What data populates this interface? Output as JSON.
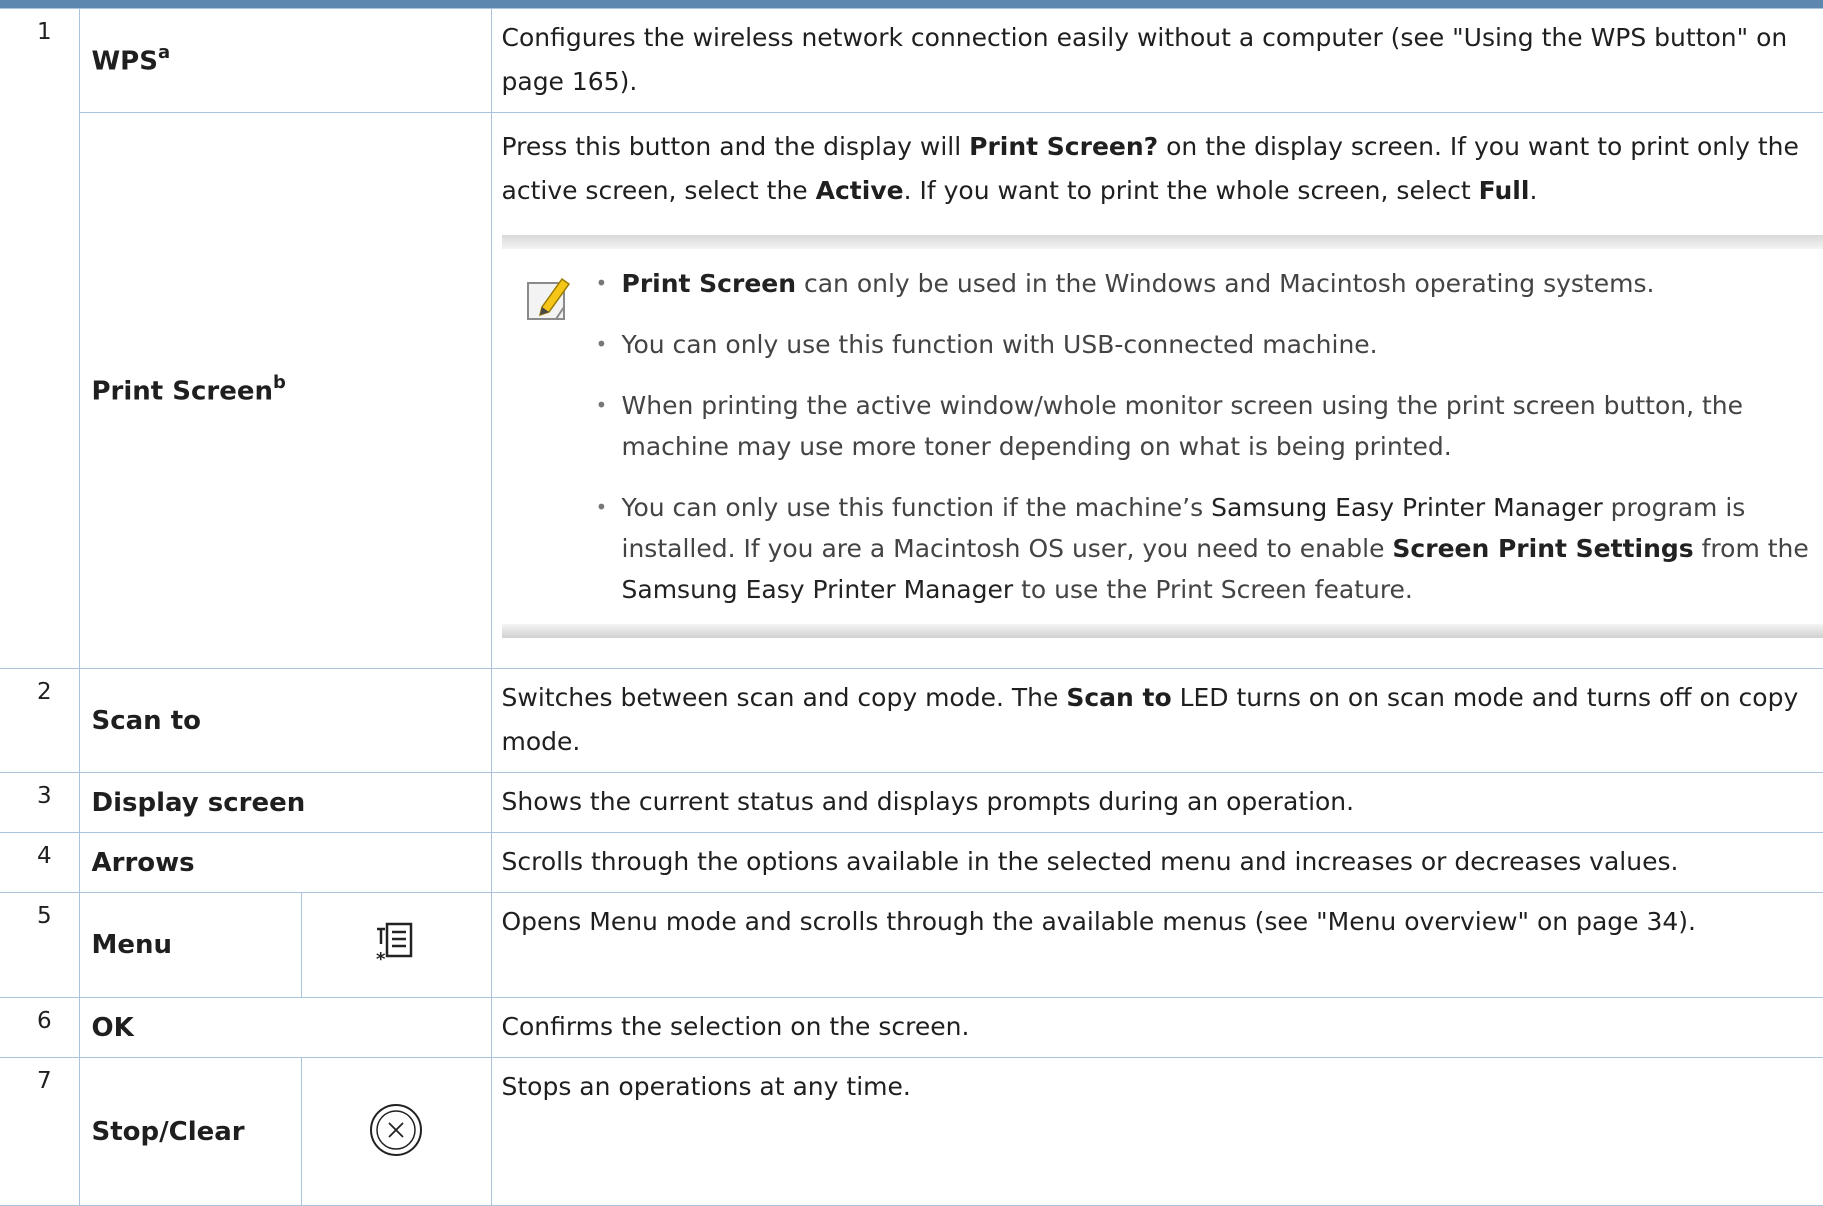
{
  "rows": [
    {
      "num": "1",
      "name": "WPS",
      "sup": "a",
      "desc": "Configures the wireless network connection easily without a computer (see \"Using the WPS button\" on page 165)."
    },
    {
      "num": "",
      "name": "Print Screen",
      "sup": "b",
      "desc_parts": {
        "p1": "Press this button and the display will ",
        "b1": "Print Screen?",
        "p2": " on the display screen. If you want to print only the active screen, select the ",
        "b2": "Active",
        "p3": ". If you want to print the whole screen, select ",
        "b3": "Full",
        "p4": "."
      },
      "note": {
        "icon": "note-pencil-icon",
        "item1_b": "Print Screen",
        "item1_rest": " can only be used in the Windows and Macintosh operating systems.",
        "item2": "You can only use this function with USB-connected machine.",
        "item3": "When printing the active window/whole monitor screen using the print screen button, the machine may use more toner depending on what is being printed.",
        "item4_a": "You can only use this function if the machine’s ",
        "item4_b": "Samsung Easy Printer Manager",
        "item4_c": " program is installed. If you are a Macintosh OS user, you need to enable ",
        "item4_d": "Screen Print Settings",
        "item4_e": " from the ",
        "item4_f": "Samsung Easy Printer Manager",
        "item4_g": " to use the Print Screen feature."
      }
    },
    {
      "num": "2",
      "name": "Scan to",
      "desc_parts": {
        "p1": "Switches between scan and copy mode. The ",
        "b1": "Scan to",
        "p2": " LED turns on on scan mode and turns off on copy mode."
      }
    },
    {
      "num": "3",
      "name": "Display screen",
      "desc": "Shows the current status and displays prompts during an operation."
    },
    {
      "num": "4",
      "name": "Arrows",
      "desc": "Scrolls through the options available in the selected menu and increases or decreases values."
    },
    {
      "num": "5",
      "name": "Menu",
      "icon": "menu-icon",
      "desc": "Opens Menu mode and scrolls through the available menus (see \"Menu overview\" on page 34)."
    },
    {
      "num": "6",
      "name": "OK",
      "desc": "Confirms the selection on the screen."
    },
    {
      "num": "7",
      "name": "Stop/Clear",
      "icon": "stop-clear-icon",
      "desc": "Stops an operations at any time."
    }
  ]
}
